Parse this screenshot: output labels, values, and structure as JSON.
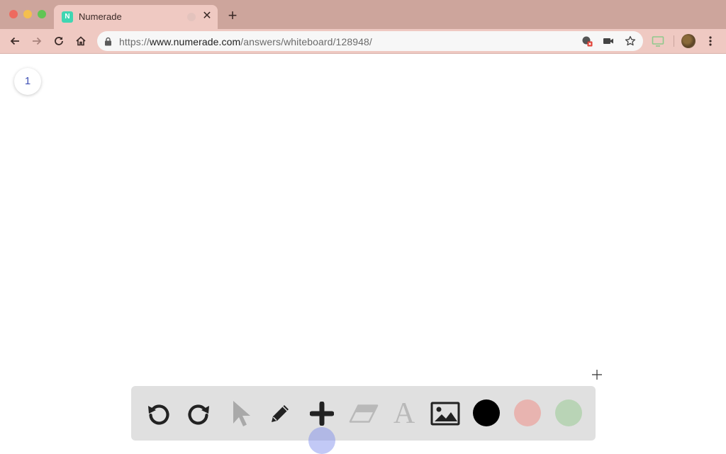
{
  "browser": {
    "tab": {
      "title": "Numerade",
      "favicon_letter": "N"
    },
    "url": {
      "scheme": "https://",
      "host": "www.numerade.com",
      "path": "/answers/whiteboard/128948/"
    },
    "icons": {
      "back": "arrow-left-icon",
      "forward": "arrow-right-icon",
      "reload": "reload-icon",
      "home": "home-icon",
      "lock": "lock-icon",
      "camera_blocked": "location-blocked-icon",
      "video": "video-camera-icon",
      "bookmark": "star-icon",
      "cast": "cast-icon",
      "menu": "kebab-menu-icon"
    }
  },
  "whiteboard": {
    "page_number": "1",
    "tools": [
      {
        "name": "undo",
        "icon": "undo-icon"
      },
      {
        "name": "redo",
        "icon": "redo-icon"
      },
      {
        "name": "select",
        "icon": "pointer-icon",
        "enabled": false
      },
      {
        "name": "pen",
        "icon": "pencil-icon"
      },
      {
        "name": "add",
        "icon": "plus-icon"
      },
      {
        "name": "eraser",
        "icon": "eraser-icon",
        "enabled": false
      },
      {
        "name": "text",
        "icon": "text-icon",
        "label": "A",
        "enabled": false
      },
      {
        "name": "image",
        "icon": "image-icon"
      }
    ],
    "colors": [
      {
        "name": "black",
        "hex": "#000000",
        "selected": true
      },
      {
        "name": "red",
        "hex": "#e8b4b0"
      },
      {
        "name": "green",
        "hex": "#b9d4b6"
      }
    ]
  }
}
